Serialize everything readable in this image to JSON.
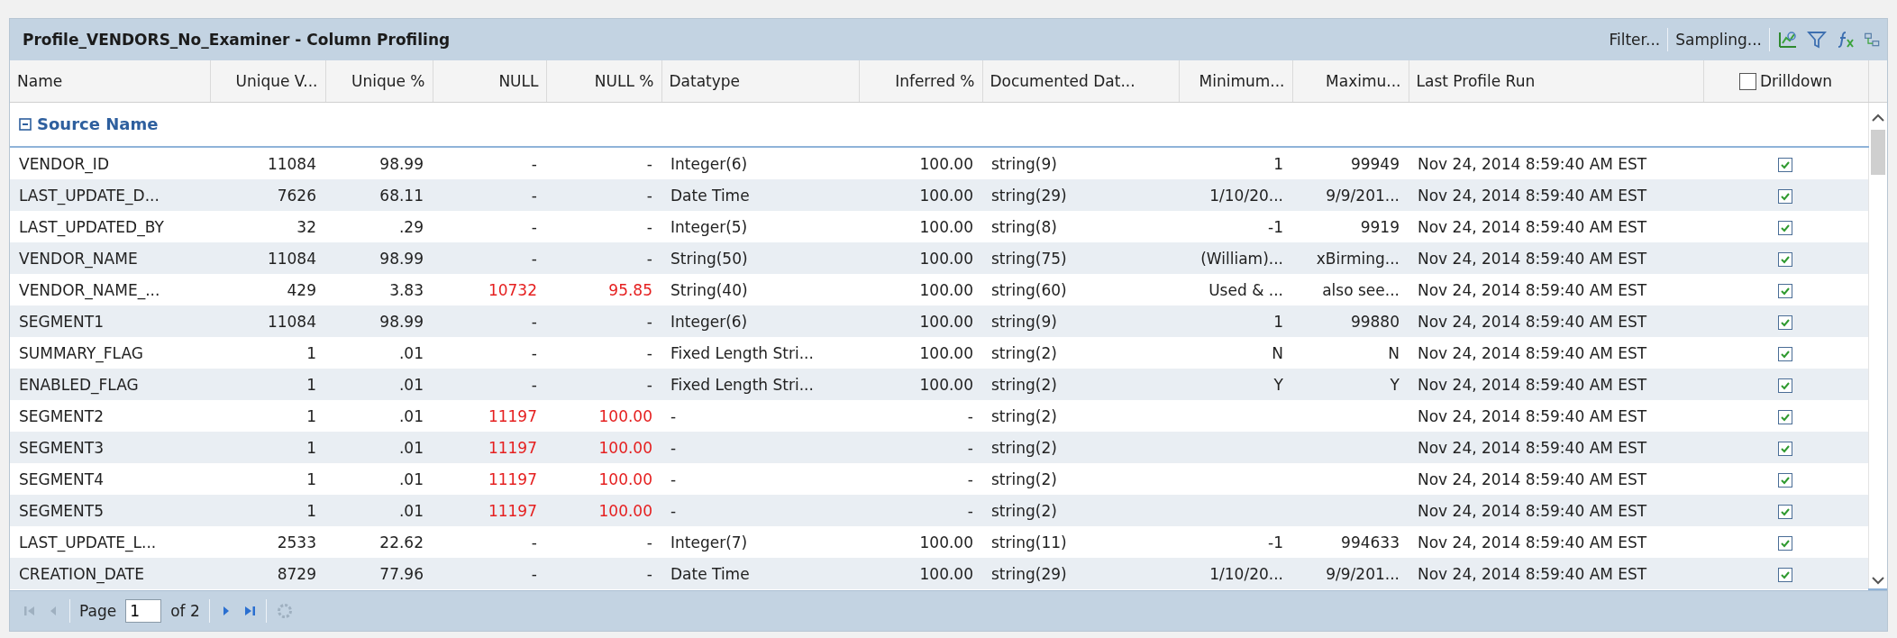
{
  "window": {
    "title": "Profile_VENDORS_No_Examiner - Column Profiling"
  },
  "toolbar": {
    "links": [
      "Filter...",
      "Sampling..."
    ]
  },
  "table": {
    "columns": [
      "Name",
      "Unique V...",
      "Unique %",
      "NULL",
      "NULL %",
      "Datatype",
      "Inferred %",
      "Documented Dat...",
      "Minimum...",
      "Maximu...",
      "Last Profile Run"
    ],
    "drilldown_header": {
      "label": "Drilldown",
      "checked": false
    },
    "group": {
      "label": "Source Name",
      "expanded": true
    },
    "rows": [
      {
        "cells": [
          "VENDOR_ID",
          "11084",
          "98.99",
          "-",
          "-",
          "Integer(6)",
          "100.00",
          "string(9)",
          "1",
          "99949",
          "Nov 24, 2014 8:59:40 AM EST"
        ],
        "null_alert": false,
        "drilldown": true
      },
      {
        "cells": [
          "LAST_UPDATE_D...",
          "7626",
          "68.11",
          "-",
          "-",
          "Date Time",
          "100.00",
          "string(29)",
          "1/10/20...",
          "9/9/201...",
          "Nov 24, 2014 8:59:40 AM EST"
        ],
        "null_alert": false,
        "drilldown": true
      },
      {
        "cells": [
          "LAST_UPDATED_BY",
          "32",
          ".29",
          "-",
          "-",
          "Integer(5)",
          "100.00",
          "string(8)",
          "-1",
          "9919",
          "Nov 24, 2014 8:59:40 AM EST"
        ],
        "null_alert": false,
        "drilldown": true
      },
      {
        "cells": [
          "VENDOR_NAME",
          "11084",
          "98.99",
          "-",
          "-",
          "String(50)",
          "100.00",
          "string(75)",
          "(William)...",
          "xBirming...",
          "Nov 24, 2014 8:59:40 AM EST"
        ],
        "null_alert": false,
        "drilldown": true
      },
      {
        "cells": [
          "VENDOR_NAME_...",
          "429",
          "3.83",
          "10732",
          "95.85",
          "String(40)",
          "100.00",
          "string(60)",
          "Used & ...",
          "also see...",
          "Nov 24, 2014 8:59:40 AM EST"
        ],
        "null_alert": true,
        "drilldown": true
      },
      {
        "cells": [
          "SEGMENT1",
          "11084",
          "98.99",
          "-",
          "-",
          "Integer(6)",
          "100.00",
          "string(9)",
          "1",
          "99880",
          "Nov 24, 2014 8:59:40 AM EST"
        ],
        "null_alert": false,
        "drilldown": true
      },
      {
        "cells": [
          "SUMMARY_FLAG",
          "1",
          ".01",
          "-",
          "-",
          "Fixed Length Stri...",
          "100.00",
          "string(2)",
          "N",
          "N",
          "Nov 24, 2014 8:59:40 AM EST"
        ],
        "null_alert": false,
        "drilldown": true
      },
      {
        "cells": [
          "ENABLED_FLAG",
          "1",
          ".01",
          "-",
          "-",
          "Fixed Length Stri...",
          "100.00",
          "string(2)",
          "Y",
          "Y",
          "Nov 24, 2014 8:59:40 AM EST"
        ],
        "null_alert": false,
        "drilldown": true
      },
      {
        "cells": [
          "SEGMENT2",
          "1",
          ".01",
          "11197",
          "100.00",
          "-",
          "-",
          "string(2)",
          "",
          "",
          "Nov 24, 2014 8:59:40 AM EST"
        ],
        "null_alert": true,
        "drilldown": true
      },
      {
        "cells": [
          "SEGMENT3",
          "1",
          ".01",
          "11197",
          "100.00",
          "-",
          "-",
          "string(2)",
          "",
          "",
          "Nov 24, 2014 8:59:40 AM EST"
        ],
        "null_alert": true,
        "drilldown": true
      },
      {
        "cells": [
          "SEGMENT4",
          "1",
          ".01",
          "11197",
          "100.00",
          "-",
          "-",
          "string(2)",
          "",
          "",
          "Nov 24, 2014 8:59:40 AM EST"
        ],
        "null_alert": true,
        "drilldown": true
      },
      {
        "cells": [
          "SEGMENT5",
          "1",
          ".01",
          "11197",
          "100.00",
          "-",
          "-",
          "string(2)",
          "",
          "",
          "Nov 24, 2014 8:59:40 AM EST"
        ],
        "null_alert": true,
        "drilldown": true
      },
      {
        "cells": [
          "LAST_UPDATE_L...",
          "2533",
          "22.62",
          "-",
          "-",
          "Integer(7)",
          "100.00",
          "string(11)",
          "-1",
          "994633",
          "Nov 24, 2014 8:59:40 AM EST"
        ],
        "null_alert": false,
        "drilldown": true
      },
      {
        "cells": [
          "CREATION_DATE",
          "8729",
          "77.96",
          "-",
          "-",
          "Date Time",
          "100.00",
          "string(29)",
          "1/10/20...",
          "9/9/201...",
          "Nov 24, 2014 8:59:40 AM EST"
        ],
        "null_alert": false,
        "drilldown": true
      }
    ]
  },
  "pager": {
    "page_label": "Page",
    "page": "1",
    "of_label": "of 2",
    "first_disabled": true,
    "prev_disabled": true,
    "next_disabled": false,
    "last_disabled": false,
    "refresh_disabled": true
  }
}
